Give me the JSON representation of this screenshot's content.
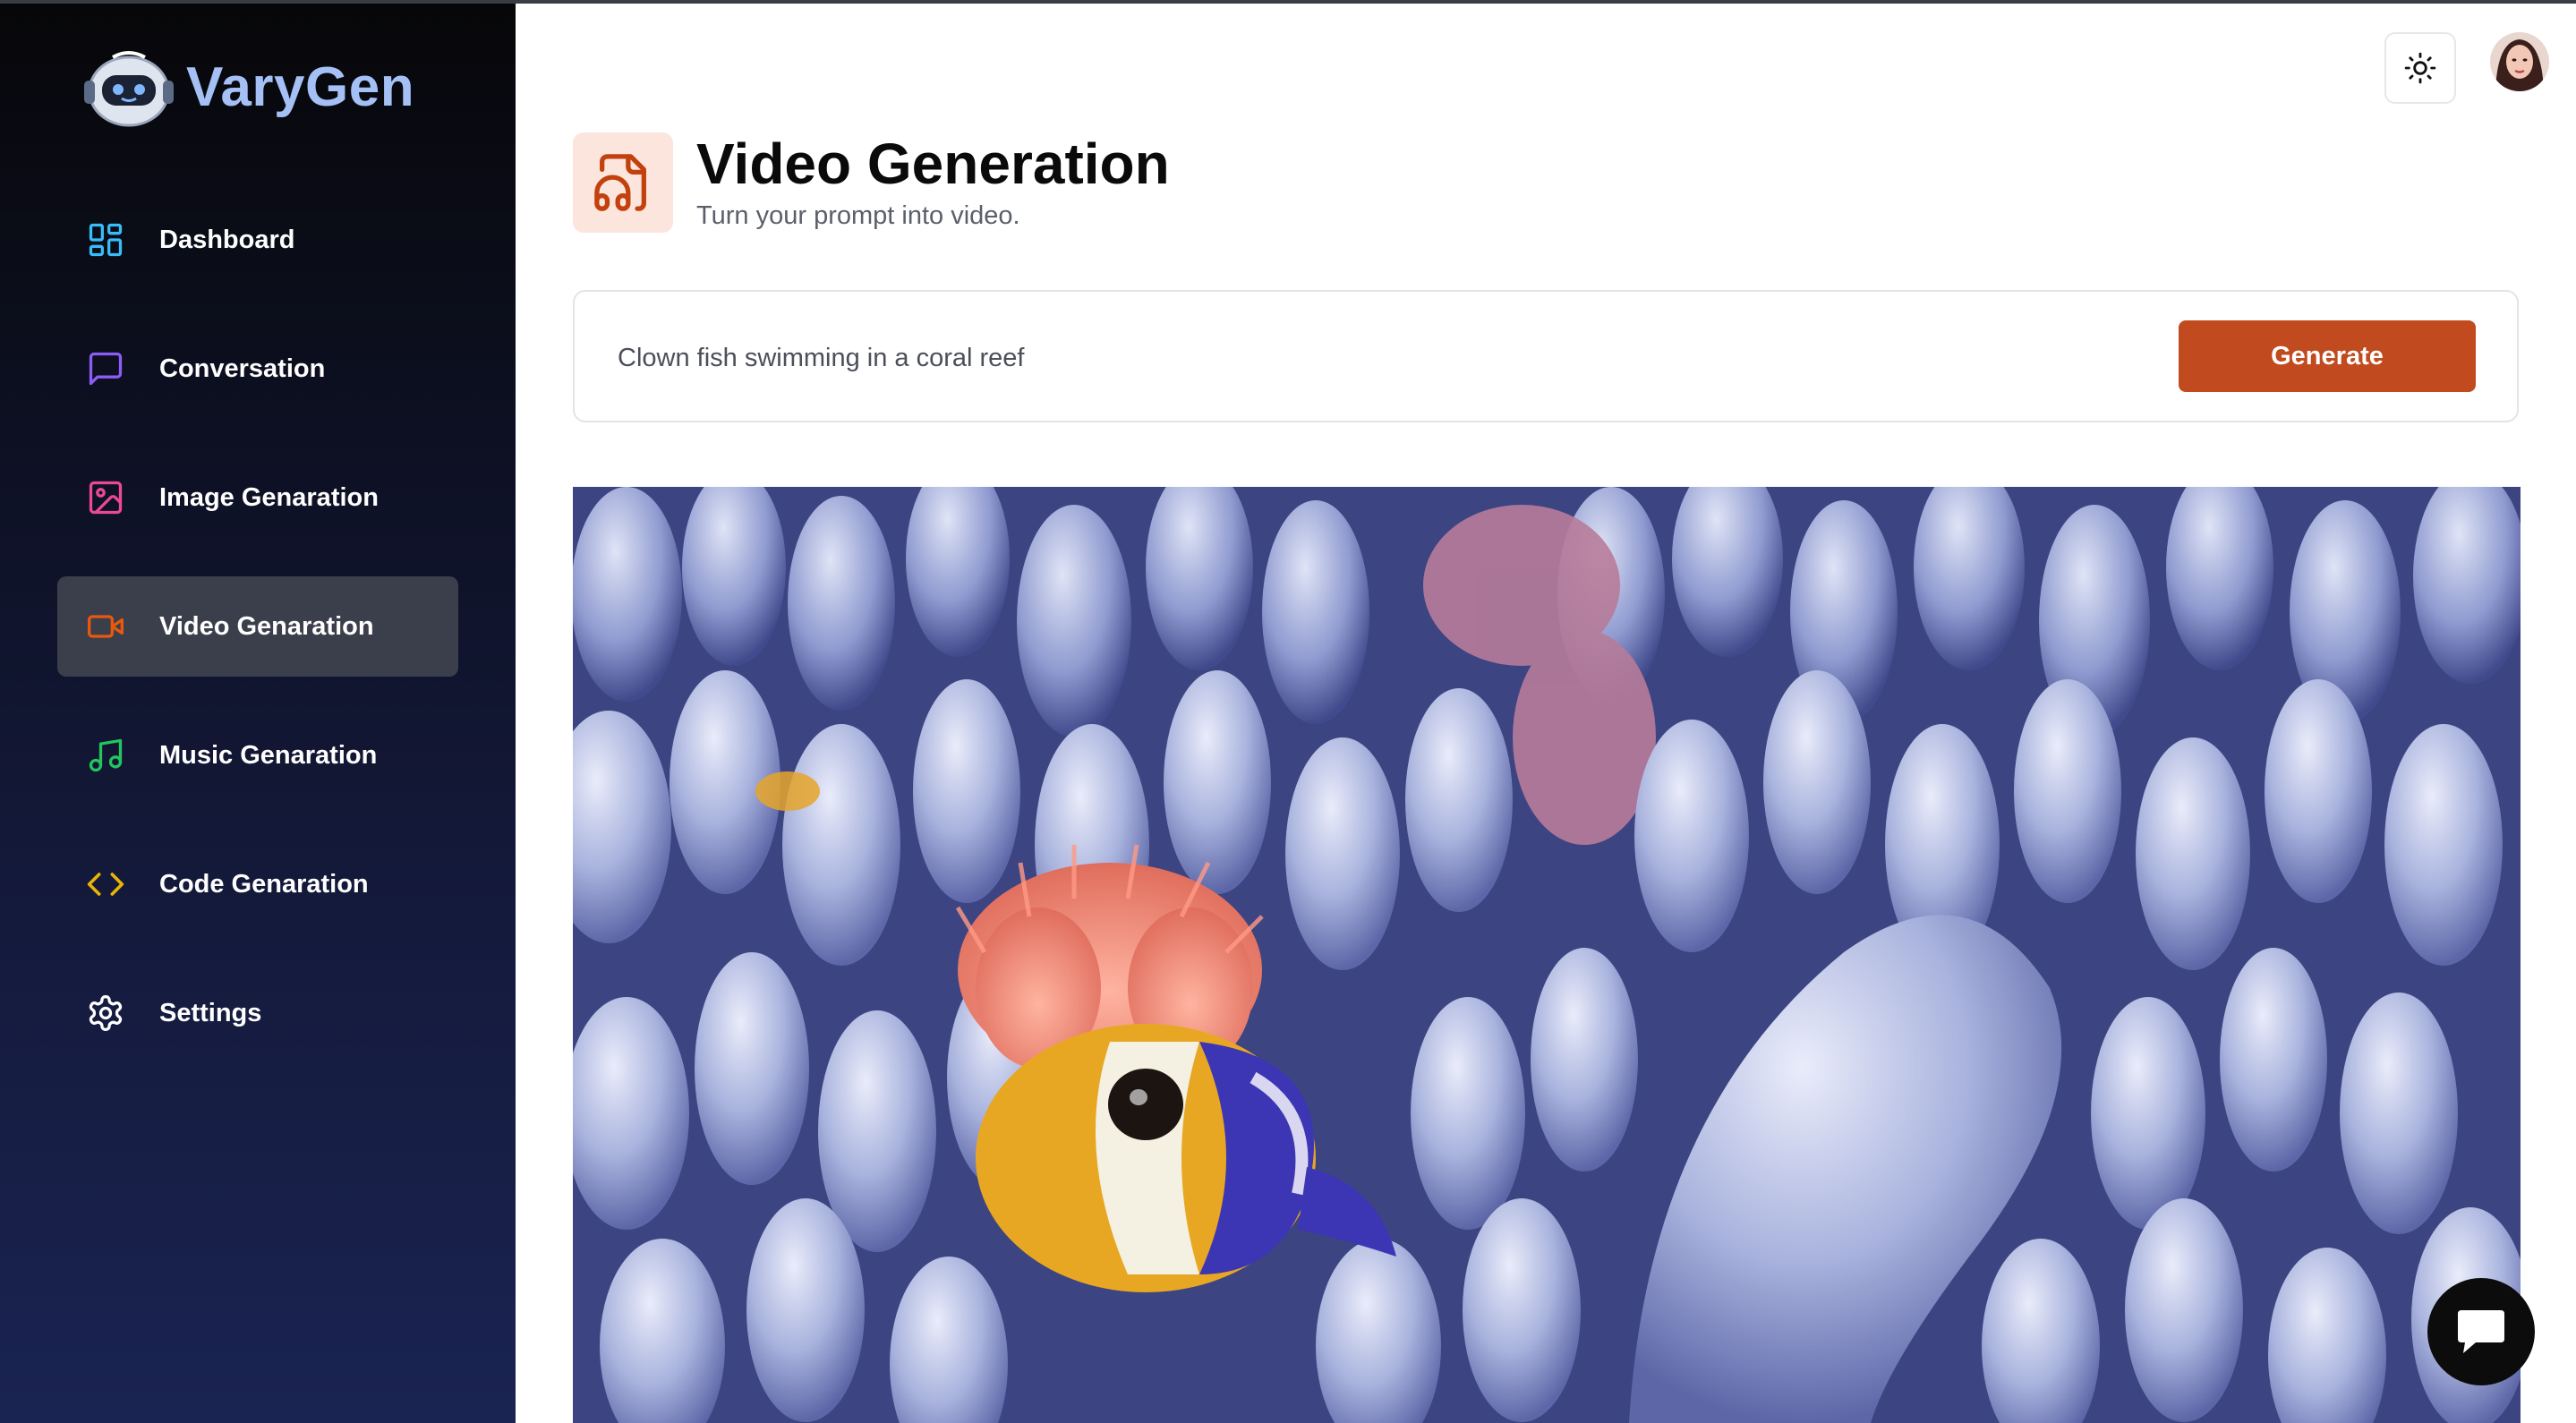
{
  "app": {
    "name": "VaryGen"
  },
  "sidebar": {
    "items": [
      {
        "label": "Dashboard",
        "icon": "layout-dashboard-icon",
        "color": "#38bdf8"
      },
      {
        "label": "Conversation",
        "icon": "message-square-icon",
        "color": "#8b5cf6"
      },
      {
        "label": "Image Genaration",
        "icon": "image-icon",
        "color": "#ec4899"
      },
      {
        "label": "Video Genaration",
        "icon": "video-icon",
        "color": "#ea580c",
        "active": true
      },
      {
        "label": "Music Genaration",
        "icon": "music-icon",
        "color": "#22c55e"
      },
      {
        "label": "Code Genaration",
        "icon": "code-icon",
        "color": "#eab308"
      },
      {
        "label": "Settings",
        "icon": "settings-icon",
        "color": "#ffffff"
      }
    ]
  },
  "header": {
    "title": "Video Generation",
    "subtitle": "Turn your prompt into video.",
    "icon": "file-audio-icon",
    "icon_color": "#c2410c",
    "icon_bg": "#fbe5dc"
  },
  "prompt": {
    "value": "Clown fish swimming in a coral reef",
    "button_label": "Generate",
    "button_color": "#c14a1e"
  },
  "topbar": {
    "theme_icon": "sun-icon",
    "avatar": "user-avatar"
  },
  "video": {
    "description_icon": "video-player"
  },
  "support": {
    "icon": "chat-bubble-icon"
  }
}
